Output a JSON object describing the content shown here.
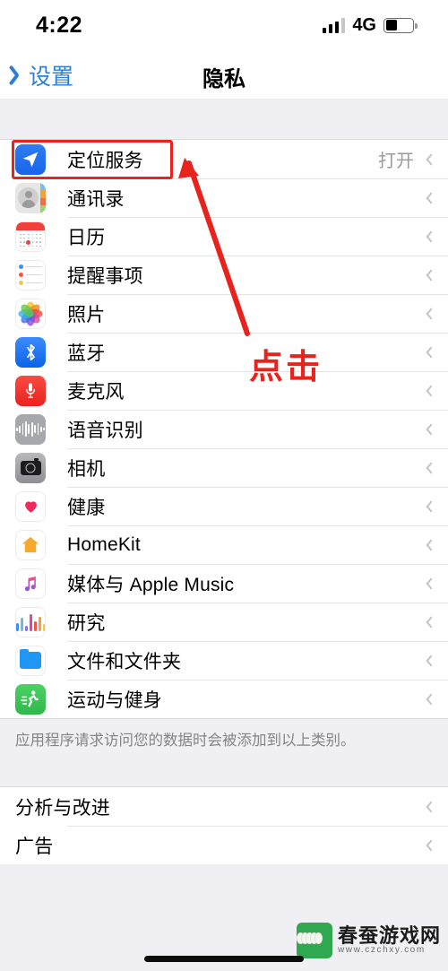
{
  "status_bar": {
    "time": "4:22",
    "network": "4G",
    "signal_icon": "signal-bars-icon",
    "battery_icon": "battery-icon",
    "battery_level_pct": 42
  },
  "nav_bar": {
    "back_label": "设置",
    "back_icon": "chevron-left-icon",
    "title": "隐私"
  },
  "privacy_list": [
    {
      "label": "定位服务",
      "value": "打开",
      "icon": "location-services-icon",
      "highlighted": true
    },
    {
      "label": "通讯录",
      "value": "",
      "icon": "contacts-icon"
    },
    {
      "label": "日历",
      "value": "",
      "icon": "calendar-icon"
    },
    {
      "label": "提醒事项",
      "value": "",
      "icon": "reminders-icon"
    },
    {
      "label": "照片",
      "value": "",
      "icon": "photos-icon"
    },
    {
      "label": "蓝牙",
      "value": "",
      "icon": "bluetooth-icon"
    },
    {
      "label": "麦克风",
      "value": "",
      "icon": "microphone-icon"
    },
    {
      "label": "语音识别",
      "value": "",
      "icon": "speech-recognition-icon"
    },
    {
      "label": "相机",
      "value": "",
      "icon": "camera-icon"
    },
    {
      "label": "健康",
      "value": "",
      "icon": "health-icon"
    },
    {
      "label": "HomeKit",
      "value": "",
      "icon": "homekit-icon"
    },
    {
      "label": "媒体与 Apple Music",
      "value": "",
      "icon": "apple-music-icon"
    },
    {
      "label": "研究",
      "value": "",
      "icon": "research-icon"
    },
    {
      "label": "文件和文件夹",
      "value": "",
      "icon": "files-and-folders-icon"
    },
    {
      "label": "运动与健身",
      "value": "",
      "icon": "motion-fitness-icon"
    }
  ],
  "footer_note": "应用程序请求访问您的数据时会被添加到以上类别。",
  "bottom_list": [
    {
      "label": "分析与改进"
    },
    {
      "label": "广告"
    }
  ],
  "annotations": {
    "tap_text": "点击",
    "accent_color": "#e8231d",
    "highlight_target": "定位服务"
  },
  "watermark": {
    "name": "春蚕游戏网",
    "url": "www.czchxy.com"
  }
}
